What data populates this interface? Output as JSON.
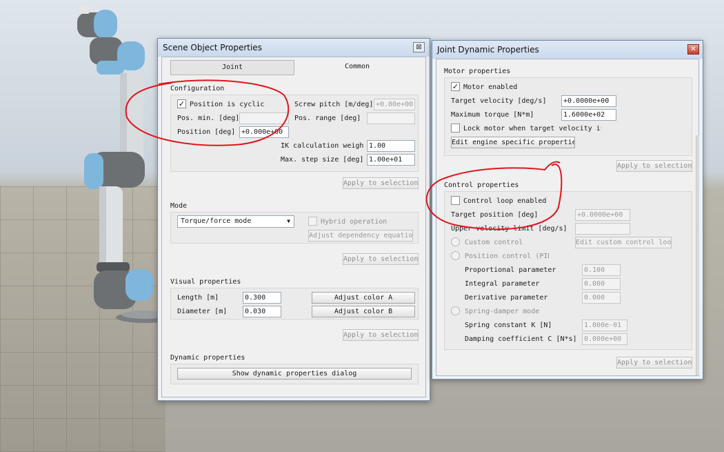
{
  "scene_object_window": {
    "title": "Scene Object Properties",
    "close_glyph": "⊠",
    "tabs": [
      "Joint",
      "Common"
    ],
    "configuration": {
      "header": "Configuration",
      "position_cyclic_label": "Position is cyclic",
      "position_cyclic_checked": true,
      "screw_pitch_label": "Screw pitch [m/deg]",
      "screw_pitch_value": "+0.00e+00",
      "pos_min_label": "Pos. min. [deg]",
      "pos_min_value": "",
      "pos_range_label": "Pos. range [deg]",
      "pos_range_value": "",
      "position_label": "Position [deg]",
      "position_value": "+0.000e+00",
      "ik_weight_label": "IK calculation weigh",
      "ik_weight_value": "1.00",
      "max_step_label": "Max. step size [deg]",
      "max_step_value": "1.00e+01",
      "apply_label": "Apply to selection"
    },
    "mode": {
      "header": "Mode",
      "selected": "Torque/force mode",
      "hybrid_label": "Hybrid operation",
      "adjust_dependency_label": "Adjust dependency equation",
      "apply_label": "Apply to selection"
    },
    "visual": {
      "header": "Visual properties",
      "length_label": "Length [m]",
      "length_value": "0.300",
      "diameter_label": "Diameter [m]",
      "diameter_value": "0.030",
      "color_a_label": "Adjust color A",
      "color_b_label": "Adjust color B",
      "apply_label": "Apply to selection"
    },
    "dynamic": {
      "header": "Dynamic properties",
      "show_dialog_label": "Show dynamic properties dialog"
    }
  },
  "joint_dynamic_window": {
    "title": "Joint Dynamic Properties",
    "close_glyph": "✕",
    "motor": {
      "header": "Motor properties",
      "motor_enabled_label": "Motor enabled",
      "motor_enabled_checked": true,
      "target_velocity_label": "Target velocity [deg/s]",
      "target_velocity_value": "+0.0000e+00",
      "max_torque_label": "Maximum torque [N*m]",
      "max_torque_value": "1.6000e+02",
      "lock_motor_label": "Lock motor when target velocity is",
      "lock_motor_checked": false,
      "edit_engine_label": "Edit engine specific properties",
      "apply_label": "Apply to selection"
    },
    "control": {
      "header": "Control properties",
      "loop_enabled_label": "Control loop enabled",
      "loop_enabled_checked": false,
      "target_position_label": "Target position [deg]",
      "target_position_value": "+0.0000e+00",
      "upper_velocity_label": "Upper velocity limit [deg/s]",
      "upper_velocity_value": "",
      "custom_control_label": "Custom control",
      "edit_custom_label": "Edit custom control loop",
      "position_control_label": "Position control (PID)",
      "proportional_label": "Proportional parameter",
      "proportional_value": "0.100",
      "integral_label": "Integral parameter",
      "integral_value": "0.000",
      "derivative_label": "Derivative parameter",
      "derivative_value": "0.000",
      "spring_damper_label": "Spring-damper mode",
      "spring_constant_label": "Spring constant K [N]",
      "spring_constant_value": "1.000e-01",
      "damping_label": "Damping coefficient C [N*s]",
      "damping_value": "0.000e+00",
      "apply_label": "Apply to selection"
    }
  },
  "colors": {
    "annotation_red": "#e0141b",
    "robot_blue": "#7fb6dc",
    "robot_gray": "#6d7073"
  }
}
